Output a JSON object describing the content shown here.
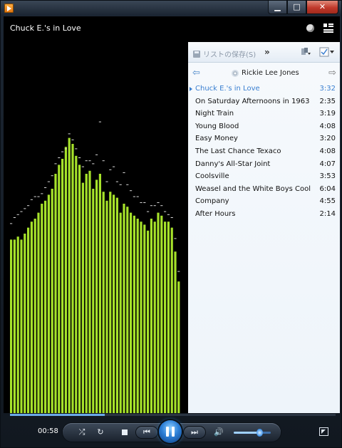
{
  "window": {
    "minimize_glyph": "▁",
    "maximize_glyph": "□",
    "close_glyph": "✕"
  },
  "now_playing": {
    "title": "Chuck E.'s in Love",
    "elapsed": "00:58",
    "progress": 0.29
  },
  "visualizer": {
    "bar_color": "#a6e22a",
    "levels": [
      0.58,
      0.58,
      0.59,
      0.58,
      0.6,
      0.62,
      0.64,
      0.65,
      0.67,
      0.7,
      0.71,
      0.73,
      0.75,
      0.8,
      0.83,
      0.85,
      0.89,
      0.92,
      0.9,
      0.86,
      0.83,
      0.77,
      0.8,
      0.81,
      0.75,
      0.78,
      0.8,
      0.74,
      0.71,
      0.74,
      0.73,
      0.72,
      0.67,
      0.7,
      0.69,
      0.67,
      0.66,
      0.65,
      0.64,
      0.63,
      0.61,
      0.65,
      0.64,
      0.67,
      0.66,
      0.64,
      0.64,
      0.62,
      0.54,
      0.44
    ],
    "peaks": [
      0.63,
      0.65,
      0.66,
      0.67,
      0.68,
      0.69,
      0.71,
      0.72,
      0.72,
      0.73,
      0.75,
      0.77,
      0.79,
      0.83,
      0.85,
      0.87,
      0.88,
      0.93,
      0.91,
      0.88,
      0.85,
      0.82,
      0.84,
      0.84,
      0.83,
      0.86,
      0.97,
      0.84,
      0.77,
      0.81,
      0.82,
      0.77,
      0.76,
      0.8,
      0.76,
      0.74,
      0.72,
      0.72,
      0.7,
      0.7,
      0.67,
      0.69,
      0.69,
      0.7,
      0.69,
      0.67,
      0.66,
      0.65,
      0.58,
      0.47
    ]
  },
  "playlist": {
    "save_label": "リストの保存(S)",
    "more_label": "»",
    "artist": "Rickie Lee Jones",
    "nav_prev_glyph": "⇦",
    "nav_next_glyph": "⇨",
    "tracks": [
      {
        "name": "Chuck E.'s in Love",
        "duration": "3:32",
        "current": true
      },
      {
        "name": "On Saturday Afternoons in 1963",
        "duration": "2:35"
      },
      {
        "name": "Night Train",
        "duration": "3:19"
      },
      {
        "name": "Young Blood",
        "duration": "4:08"
      },
      {
        "name": "Easy Money",
        "duration": "3:20"
      },
      {
        "name": "The Last Chance Texaco",
        "duration": "4:08"
      },
      {
        "name": "Danny's All-Star Joint",
        "duration": "4:07"
      },
      {
        "name": "Coolsville",
        "duration": "3:53"
      },
      {
        "name": "Weasel and the White Boys Cool",
        "duration": "6:04"
      },
      {
        "name": "Company",
        "duration": "4:55"
      },
      {
        "name": "After Hours",
        "duration": "2:14"
      }
    ]
  },
  "controls": {
    "shuffle_glyph": "⤮",
    "repeat_glyph": "↻",
    "prev_glyph": "⏮",
    "next_glyph": "⏭",
    "mute_glyph": "🔊",
    "volume": 0.7
  }
}
